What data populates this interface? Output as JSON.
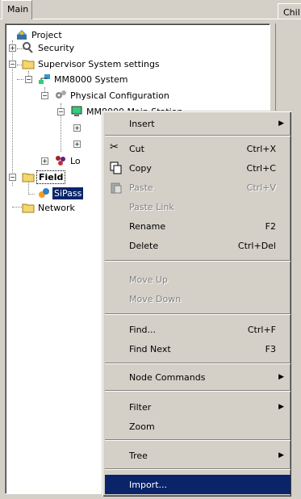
{
  "tabs": {
    "main": "Main",
    "child": "Chil"
  },
  "tree": {
    "project": "Project",
    "security": "Security",
    "supervisor": "Supervisor System settings",
    "mm8000": "MM8000 System",
    "physical": "Physical Configuration",
    "hidden_child": "MM8000 Main Station",
    "lo": "Lo",
    "field": "Field",
    "sipass": "SiPass",
    "network": "Network"
  },
  "menu": {
    "insert": "Insert",
    "cut": "Cut",
    "cut_short": "Ctrl+X",
    "copy": "Copy",
    "copy_short": "Ctrl+C",
    "paste": "Paste",
    "paste_short": "Ctrl+V",
    "paste_link": "Paste Link",
    "rename": "Rename",
    "rename_short": "F2",
    "delete": "Delete",
    "delete_short": "Ctrl+Del",
    "move_up": "Move Up",
    "move_down": "Move Down",
    "find": "Find...",
    "find_short": "Ctrl+F",
    "find_next": "Find Next",
    "find_next_short": "F3",
    "node_commands": "Node Commands",
    "filter": "Filter",
    "zoom": "Zoom",
    "tree": "Tree",
    "import": "Import..."
  },
  "colors": {
    "highlight": "#0a246a",
    "face": "#d4d0c8"
  }
}
